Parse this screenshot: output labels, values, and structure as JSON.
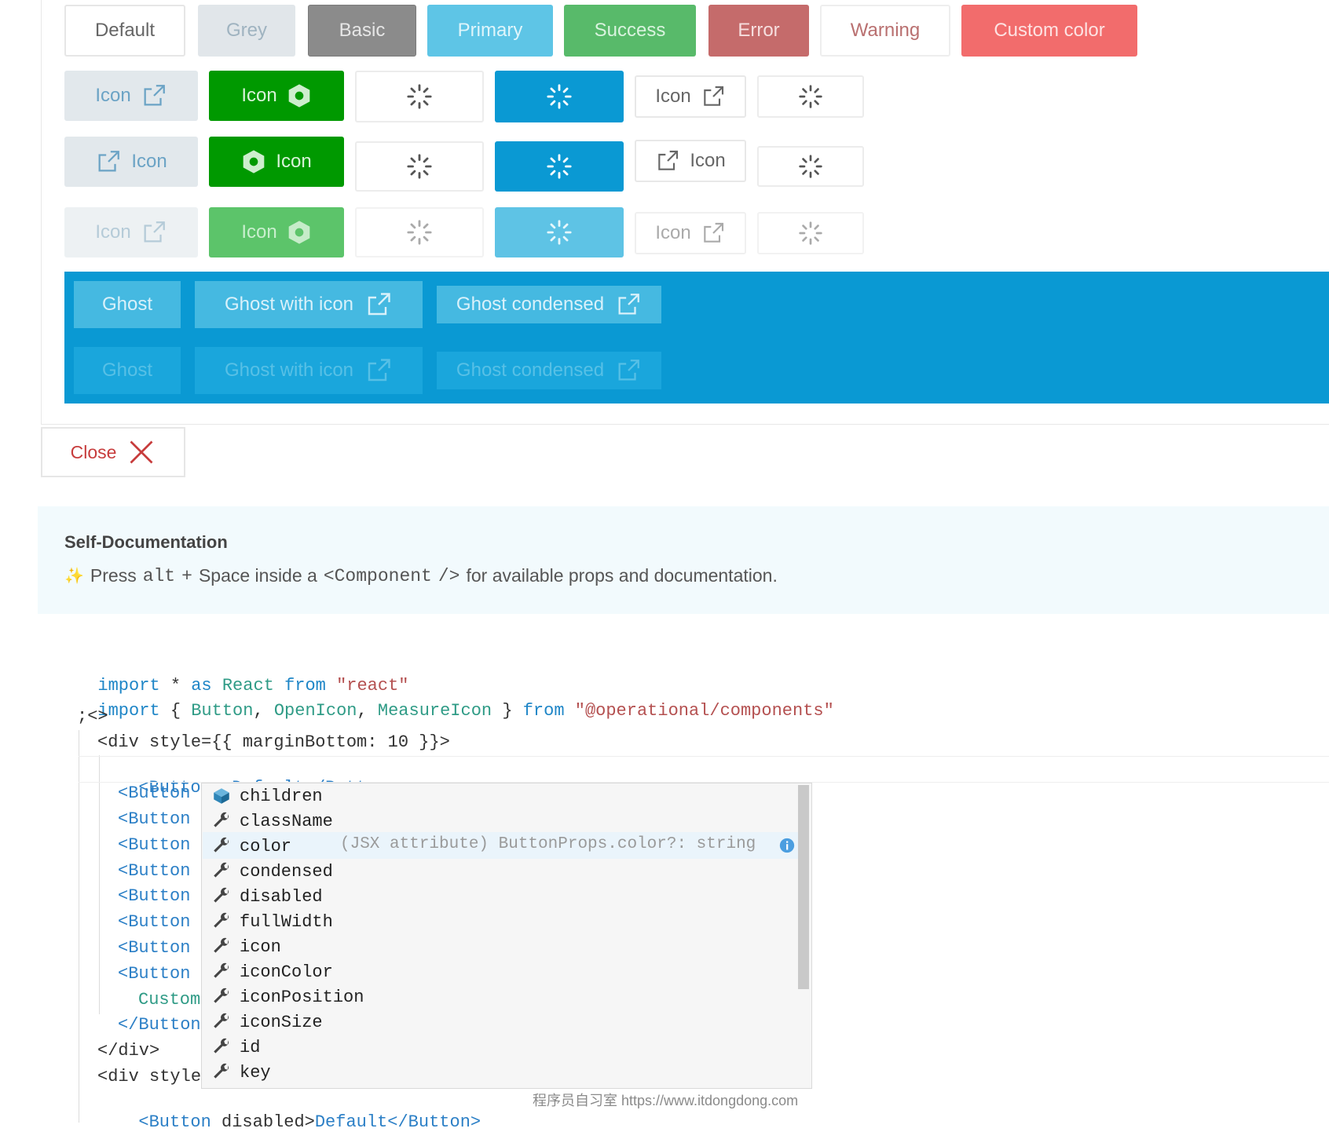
{
  "row1": [
    "Default",
    "Grey",
    "Basic",
    "Primary",
    "Success",
    "Error",
    "Warning",
    "Custom color"
  ],
  "icon_label": "Icon",
  "ghost": {
    "ghost": "Ghost",
    "ghost_with_icon": "Ghost with icon",
    "ghost_condensed": "Ghost condensed"
  },
  "close_label": "Close",
  "selfdoc": {
    "title": "Self-Documentation",
    "press": "Press",
    "alt": "alt",
    "plus": "+",
    "space_inside": "Space inside a",
    "component": "<Component",
    "close_tag": "/>",
    "rest": "for available props and documentation."
  },
  "code": {
    "l1_import": "import",
    "l1_star": " * ",
    "l1_as": "as",
    "l1_react": " React ",
    "l1_from": "from",
    "l1_str": " \"react\"",
    "l2_import": "import",
    "l2_open": " { ",
    "l2_button": "Button",
    "l2_c1": ", ",
    "l2_openicon": "OpenIcon",
    "l2_c2": ", ",
    "l2_measure": "MeasureIcon",
    "l2_close": " } ",
    "l2_from": "from",
    "l2_str": " \"@operational/components\"",
    "l3": ";<>",
    "l4": "<div style={{ marginBottom: 10 }}>",
    "l5_tag": "<Button",
    "l5_rest": " >Default</Button>",
    "btn_tag": "<Button",
    "custom": "Custom",
    "btn_close": "</Button",
    "div_close": "</div>",
    "div_style": "<div style",
    "last_tag": "<Button",
    "last_attr": " disabled>",
    "last_text": "Default</Button>"
  },
  "autocomplete": {
    "items": [
      "children",
      "className",
      "color",
      "condensed",
      "disabled",
      "fullWidth",
      "icon",
      "iconColor",
      "iconPosition",
      "iconSize",
      "id",
      "key"
    ],
    "selected_detail": "(JSX attribute) ButtonProps.color?: string"
  },
  "watermark": "程序员自习室 https://www.itdongdong.com",
  "colors": {
    "primary": "#0a99d3",
    "success": "#009900",
    "error": "#c56b6b",
    "custom": "#f26c6c"
  }
}
